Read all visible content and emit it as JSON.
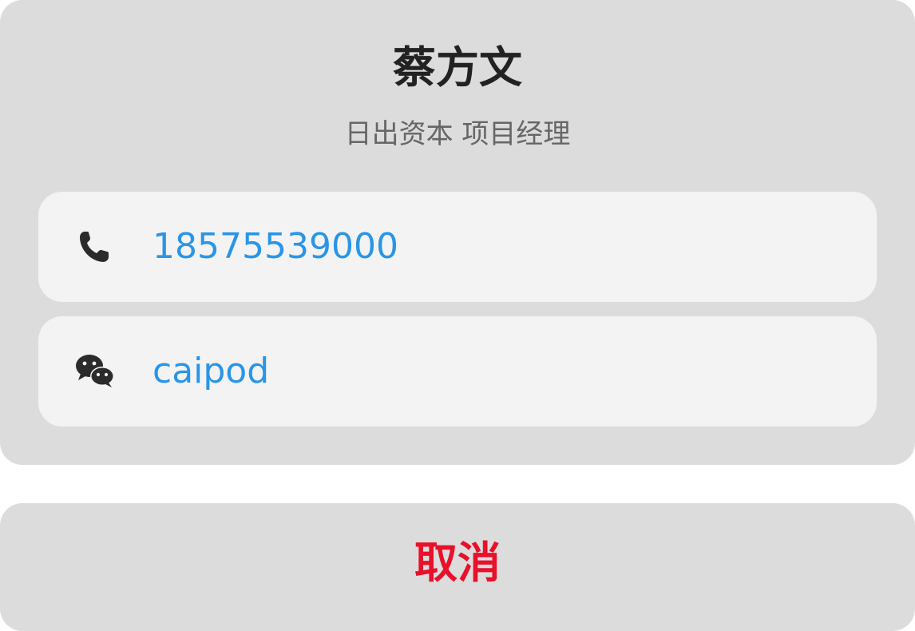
{
  "contact": {
    "name": "蔡方文",
    "subtitle": "日出资本 项目经理"
  },
  "rows": [
    {
      "icon": "phone-icon",
      "value": "18575539000"
    },
    {
      "icon": "wechat-icon",
      "value": "caipod"
    }
  ],
  "actions": {
    "cancel_label": "取消"
  },
  "colors": {
    "link": "#2a95e6",
    "cancel": "#e8102a",
    "sheet_bg": "#dcdcdc",
    "row_bg": "#f3f3f3"
  }
}
